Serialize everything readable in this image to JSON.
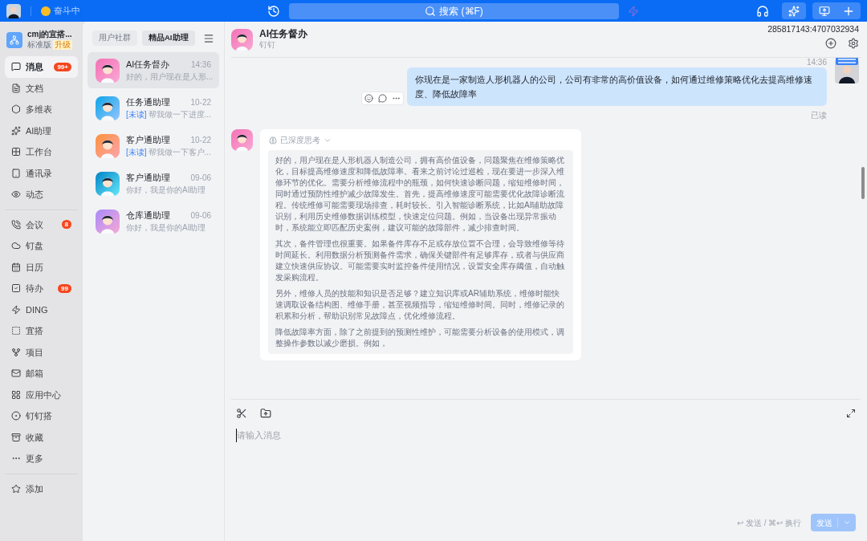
{
  "topbar": {
    "status": "奋斗中",
    "search": "搜索 (⌘F)"
  },
  "workspace": {
    "name": "cmj的宜搭...",
    "edition": "标准版",
    "upgrade": "升级"
  },
  "nav_groups": [
    [
      {
        "label": "消息",
        "badge": "99+",
        "selected": true
      },
      {
        "label": "文档",
        "selected": false
      },
      {
        "label": "多维表",
        "selected": false
      },
      {
        "label": "AI助理",
        "selected": false
      },
      {
        "label": "工作台",
        "selected": false
      },
      {
        "label": "通讯录",
        "selected": false
      },
      {
        "label": "动态",
        "selected": false
      }
    ],
    [
      {
        "label": "会议",
        "badge": "8",
        "selected": false
      },
      {
        "label": "钉盘",
        "selected": false
      },
      {
        "label": "日历",
        "selected": false
      },
      {
        "label": "待办",
        "badge": "99",
        "selected": false
      },
      {
        "label": "DING",
        "selected": false
      },
      {
        "label": "宜搭",
        "selected": false
      },
      {
        "label": "项目",
        "selected": false
      },
      {
        "label": "邮箱",
        "selected": false
      },
      {
        "label": "应用中心",
        "selected": false
      },
      {
        "label": "钉钉搭",
        "selected": false
      },
      {
        "label": "收藏",
        "selected": false
      },
      {
        "label": "更多",
        "selected": false
      }
    ],
    [
      {
        "label": "添加",
        "selected": false
      }
    ]
  ],
  "list_tabs": [
    {
      "label": "用户社群",
      "selected": false
    },
    {
      "label": "精品AI助理",
      "selected": true
    }
  ],
  "conversations": [
    {
      "name": "AI任务督办",
      "time": "14:36",
      "preview": "好的，用户现在是人形...",
      "selected": true
    },
    {
      "name": "任务通助理",
      "time": "10-22",
      "tag": "[未读]",
      "preview": "帮我做一下进度...",
      "selected": false
    },
    {
      "name": "客户通助理",
      "time": "10-22",
      "tag": "[未读]",
      "preview": "帮我做一下客户...",
      "selected": false
    },
    {
      "name": "客户通助理",
      "time": "09-06",
      "preview": "你好，我是你的AI助理",
      "selected": false
    },
    {
      "name": "仓库通助理",
      "time": "09-06",
      "preview": "你好，我是你的AI助理",
      "selected": false
    }
  ],
  "chat": {
    "title": "AI任务督办",
    "subtitle": "钉钉",
    "id_text": "285817143:4707032934",
    "user_message": {
      "time": "14:36",
      "text": "你现在是一家制造人形机器人的公司，公司有非常的高价值设备，如何通过维修策略优化去提高维修速度、降低故障率",
      "status": "已读"
    },
    "ai_message": {
      "thinking_label": "已深度思考",
      "paragraphs": [
        "好的，用户现在是人形机器人制造公司，拥有高价值设备，问题聚焦在维修策略优化，目标提高维修速度和降低故障率。看来之前讨论过巡检，现在要进一步深入维修环节的优化。需要分析维修流程中的瓶颈，如何快速诊断问题，缩短维修时间，同时通过预防性维护减少故障发生。首先，提高维修速度可能需要优化故障诊断流程。传统维修可能需要现场排查，耗时较长。引入智能诊断系统，比如AI辅助故障识别，利用历史维修数据训练模型，快速定位问题。例如，当设备出现异常振动时，系统能立即匹配历史案例，建议可能的故障部件，减少排查时间。",
        "其次，备件管理也很重要。如果备件库存不足或存放位置不合理，会导致维修等待时间延长。利用数据分析预测备件需求，确保关键部件有足够库存，或者与供应商建立快速供应协议。可能需要实时监控备件使用情况，设置安全库存阈值，自动触发采购流程。",
        "另外，维修人员的技能和知识是否足够？建立知识库或AR辅助系统，维修时能快速调取设备结构图、维修手册，甚至视频指导，缩短维修时间。同时，维修记录的积累和分析，帮助识别常见故障点，优化维修流程。",
        "降低故障率方面，除了之前提到的预测性维护，可能需要分析设备的使用模式，调整操作参数以减少磨损。例如，"
      ]
    }
  },
  "composer": {
    "placeholder": "请输入消息",
    "hint": "↩ 发送 / ⌘↩ 换行",
    "send": "发送"
  }
}
